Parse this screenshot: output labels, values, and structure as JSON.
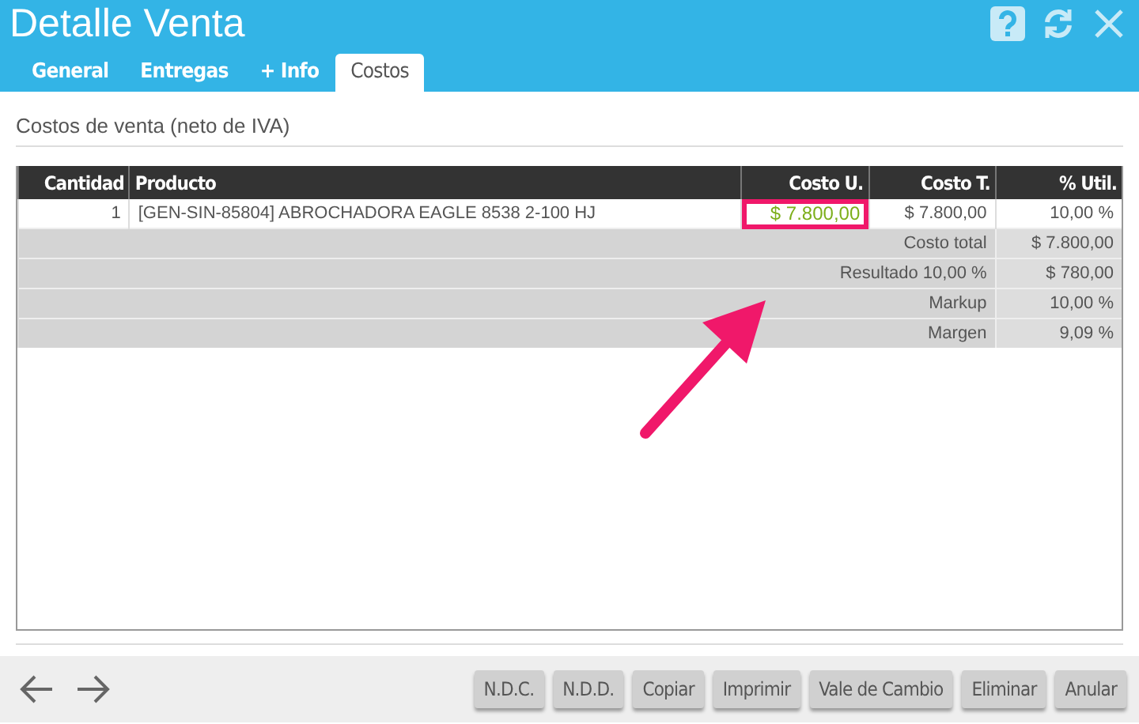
{
  "window": {
    "title": "Detalle Venta"
  },
  "tabs": [
    {
      "label": "General",
      "selected": false
    },
    {
      "label": "Entregas",
      "selected": false
    },
    {
      "label": "+ Info",
      "selected": false
    },
    {
      "label": "Costos",
      "selected": true
    }
  ],
  "section_title": "Costos de venta (neto de IVA)",
  "table": {
    "columns": [
      "Cantidad",
      "Producto",
      "Costo U.",
      "Costo T.",
      "% Util."
    ],
    "rows": [
      {
        "cells": [
          {
            "text": "1",
            "highlighted": false
          },
          {
            "text": "[GEN-SIN-85804] ABROCHADORA EAGLE 8538 2-100 HJ",
            "highlighted": false
          },
          {
            "text": "$ 7.800,00",
            "highlighted": true
          },
          {
            "text": "$ 7.800,00",
            "highlighted": false
          },
          {
            "text": "10,00 %",
            "highlighted": false
          }
        ]
      }
    ],
    "summary": [
      {
        "label": "Costo total",
        "value": "$ 7.800,00"
      },
      {
        "label": "Resultado 10,00 %",
        "value": "$ 780,00"
      },
      {
        "label": "Markup",
        "value": "10,00 %"
      },
      {
        "label": "Margen",
        "value": "9,09 %"
      }
    ]
  },
  "buttons": [
    "N.D.C.",
    "N.D.D.",
    "Copiar",
    "Imprimir",
    "Vale de Cambio",
    "Eliminar",
    "Anular"
  ]
}
